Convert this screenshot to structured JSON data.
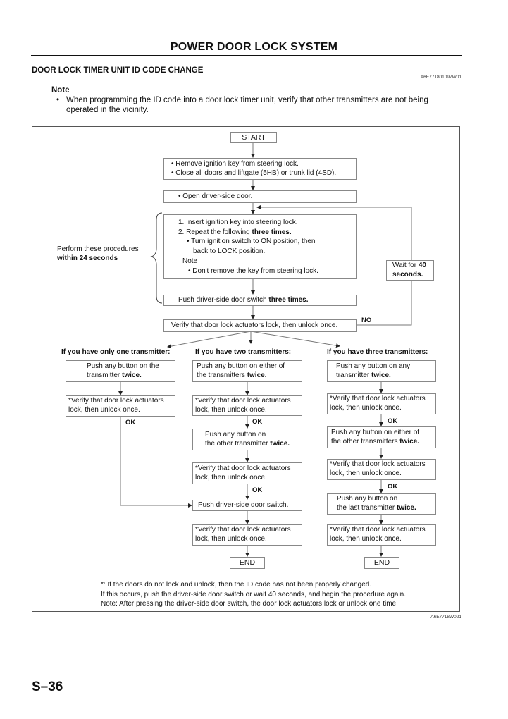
{
  "page": {
    "title": "POWER DOOR LOCK SYSTEM",
    "section_title": "DOOR LOCK TIMER UNIT ID CODE CHANGE",
    "doc_code": "A6E771801097W01",
    "note_label": "Note",
    "note_bullet": "•",
    "note_text": "When programming the ID code into a door lock timer unit, verify that other transmitters are not being operated in the vicinity.",
    "figure_code": "A6E7718W021",
    "page_number": "S–36"
  },
  "flow": {
    "start": "START",
    "step1": {
      "line1": "• Remove ignition key from steering lock.",
      "line2": "• Close all doors and liftgate (5HB) or trunk lid (4SD)."
    },
    "step2": "• Open driver-side door.",
    "step3": {
      "line1": "1. Insert ignition key into steering lock.",
      "line2_pre": "2. Repeat the following ",
      "line2_bold": "three times.",
      "line3": "• Turn ignition switch to ON position, then",
      "line4": "back to LOCK position.",
      "note_label": "Note",
      "note_text": "• Don't remove the key from steering lock."
    },
    "step4": {
      "pre": "Push driver-side door switch ",
      "bold": "three times."
    },
    "verify_main": "Verify that door lock actuators lock, then unlock once.",
    "no_label": "NO",
    "wait": {
      "pre": "Wait for ",
      "bold1": "40",
      "bold2": "seconds."
    },
    "bracket_note": {
      "line1": "Perform these procedures",
      "line2": "within 24 seconds"
    },
    "ok_label": "OK",
    "end_label": "END",
    "columns": [
      {
        "heading": "If you have only one transmitter:",
        "push1": {
          "line1": "Push any button on the",
          "pre": "transmitter ",
          "bold": "twice."
        },
        "verify1": {
          "line1": "*Verify that door lock actuators",
          "line2": "lock, then unlock once."
        }
      },
      {
        "heading": "If you have two transmitters:",
        "push1": {
          "line1": "Push any button on either of",
          "pre": "the transmitters ",
          "bold": "twice."
        },
        "verify1": {
          "line1": "*Verify that door lock actuators",
          "line2": "lock, then unlock once."
        },
        "push2": {
          "line1": "Push any button on",
          "pre": "the other transmitter ",
          "bold": "twice."
        },
        "verify2": {
          "line1": "*Verify that door lock actuators",
          "line2": "lock, then unlock once."
        },
        "push_door": "Push driver-side door switch.",
        "verify3": {
          "line1": "*Verify that door lock actuators",
          "line2": "lock, then unlock once."
        }
      },
      {
        "heading": "If you have three transmitters:",
        "push1": {
          "line1": "Push any button on any",
          "pre": "transmitter ",
          "bold": "twice."
        },
        "verify1": {
          "line1": "*Verify that door lock actuators",
          "line2": "lock, then unlock once."
        },
        "push2": {
          "line1": "Push any button on either of",
          "pre": "the other transmitters ",
          "bold": "twice."
        },
        "verify2": {
          "line1": "*Verify that door lock actuators",
          "line2": "lock, then unlock once."
        },
        "push3": {
          "line1": "Push any button on",
          "pre": "the last transmitter ",
          "bold": "twice."
        },
        "verify3": {
          "line1": "*Verify that door lock actuators",
          "line2": "lock, then unlock once."
        }
      }
    ],
    "footnote": [
      "*: If the doors do not lock and unlock, then the ID code has not been properly changed.",
      "If this occurs, push the driver-side door switch or wait 40 seconds, and begin the procedure again.",
      "Note: After pressing the driver-side door switch, the door lock actuators lock or unlock one time."
    ]
  }
}
